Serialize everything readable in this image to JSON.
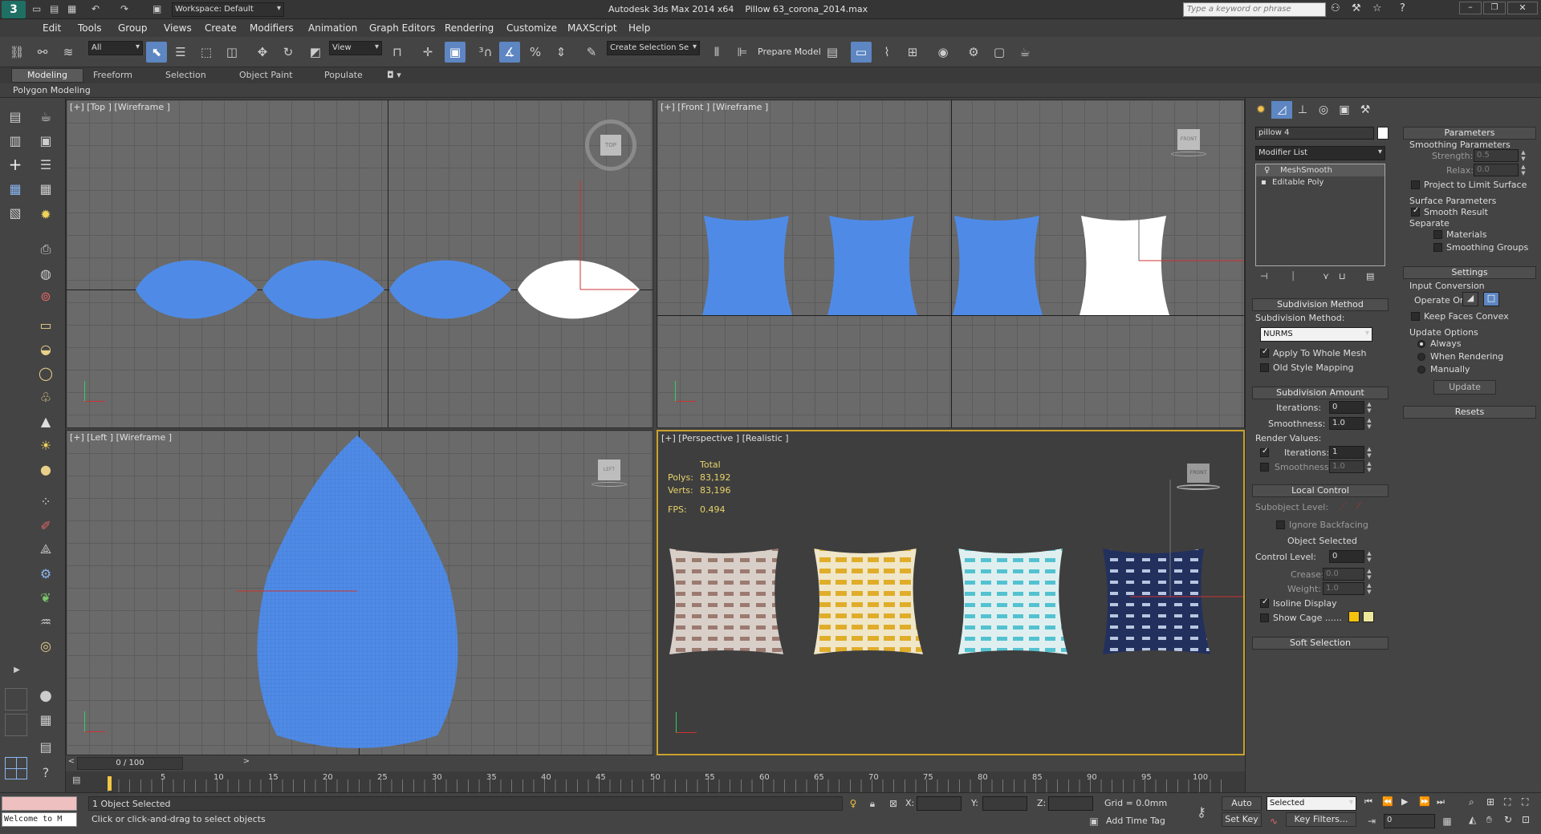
{
  "title": {
    "workspace": "Workspace: Default",
    "app_title": "Autodesk 3ds Max  2014 x64",
    "file_title": "Pillow 63_corona_2014.max",
    "search_placeholder": "Type a keyword or phrase"
  },
  "menu": [
    "Edit",
    "Tools",
    "Group",
    "Views",
    "Create",
    "Modifiers",
    "Animation",
    "Graph Editors",
    "Rendering",
    "Customize",
    "MAXScript",
    "Help"
  ],
  "toolbar": {
    "filter": "All",
    "ref_coord": "View",
    "selection_set": "Create Selection Se",
    "prepare_model": "Prepare Model"
  },
  "ribbon": {
    "tabs": [
      "Modeling",
      "Freeform",
      "Selection",
      "Object Paint",
      "Populate"
    ],
    "panel": "Polygon Modeling"
  },
  "viewports": {
    "top": "[+] [Top ] [Wireframe ]",
    "front": "[+] [Front ] [Wireframe ]",
    "left": "[+] [Left ] [Wireframe ]",
    "persp": "[+] [Perspective ] [Realistic ]",
    "cube_top": "TOP",
    "cube_front": "FRONT",
    "cube_left": "LEFT",
    "cube_persp": "FRONT"
  },
  "stats": {
    "total_label": "Total",
    "polys_label": "Polys:",
    "polys": "83,192",
    "verts_label": "Verts:",
    "verts": "83,196",
    "fps_label": "FPS:",
    "fps": "0.494"
  },
  "modify_panel": {
    "object_name": "pillow 4",
    "modifier_list": "Modifier List",
    "stack": [
      "MeshSmooth",
      "Editable Poly"
    ],
    "subdivision_method": {
      "header": "Subdivision Method",
      "label": "Subdivision Method:",
      "value": "NURMS",
      "apply_whole_mesh": "Apply To Whole Mesh",
      "old_style_mapping": "Old Style Mapping"
    },
    "subdivision_amount": {
      "header": "Subdivision Amount",
      "iterations_label": "Iterations:",
      "iterations": "0",
      "smoothness_label": "Smoothness:",
      "smoothness": "1.0",
      "render_values": "Render Values:",
      "render_iterations_label": "Iterations:",
      "render_iterations": "1",
      "render_smoothness_label": "Smoothness:",
      "render_smoothness": "1.0"
    },
    "local_control": {
      "header": "Local Control",
      "subobject_level": "Subobject Level:",
      "ignore_backfacing": "Ignore Backfacing",
      "object_selected": "Object Selected",
      "control_level_label": "Control Level:",
      "control_level": "0",
      "crease_label": "Crease:",
      "crease": "0.0",
      "weight_label": "Weight:",
      "weight": "1.0",
      "isoline_display": "Isoline Display",
      "show_cage": "Show Cage ......"
    },
    "soft_selection": "Soft Selection"
  },
  "parameters_panel": {
    "header": "Parameters",
    "smoothing_params": "Smoothing Parameters",
    "strength_label": "Strength:",
    "strength": "0.5",
    "relax_label": "Relax:",
    "relax": "0.0",
    "project_limit": "Project to Limit Surface",
    "surface_params": "Surface Parameters",
    "smooth_result": "Smooth Result",
    "separate": "Separate",
    "materials": "Materials",
    "smoothing_groups": "Smoothing Groups",
    "settings_header": "Settings",
    "input_conversion": "Input Conversion",
    "operate_on": "Operate On:",
    "keep_faces_convex": "Keep Faces Convex",
    "update_options": "Update Options",
    "always": "Always",
    "when_rendering": "When Rendering",
    "manually": "Manually",
    "update_button": "Update",
    "resets_header": "Resets"
  },
  "timeline": {
    "frame": "0 / 100",
    "ticks": [
      "5",
      "10",
      "15",
      "20",
      "25",
      "30",
      "35",
      "40",
      "45",
      "50",
      "55",
      "60",
      "65",
      "70",
      "75",
      "80",
      "85",
      "90",
      "95",
      "100"
    ]
  },
  "status": {
    "listener": "Welcome to M",
    "selected": "1 Object Selected",
    "prompt": "Click or click-and-drag to select objects",
    "x_label": "X:",
    "y_label": "Y:",
    "z_label": "Z:",
    "grid": "Grid = 0.0mm",
    "add_time_tag": "Add Time Tag",
    "auto_key": "Auto Key",
    "set_key": "Set Key",
    "selected_dd": "Selected",
    "key_filters": "Key Filters...",
    "frame_field": "0"
  },
  "colors": {
    "accent": "#5d86c2",
    "wire_blue": "#4f8be6",
    "active_viewport": "#c9a22b"
  }
}
